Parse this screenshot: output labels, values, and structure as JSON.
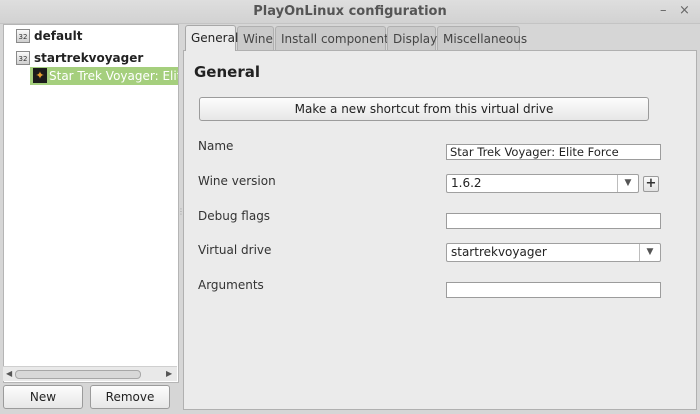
{
  "window": {
    "title": "PlayOnLinux configuration",
    "minimize_glyph": "–",
    "close_glyph": "×"
  },
  "tree": {
    "prefixes": [
      {
        "icon_text": "32",
        "label": "default"
      },
      {
        "icon_text": "32",
        "label": "startrekvoyager"
      }
    ],
    "selected_shortcut": "Star Trek Voyager:  Elite Force"
  },
  "left_buttons": {
    "new": "New",
    "remove": "Remove"
  },
  "tabs": [
    {
      "label": "General",
      "active": true
    },
    {
      "label": "Wine",
      "active": false
    },
    {
      "label": "Install components",
      "active": false
    },
    {
      "label": "Display",
      "active": false
    },
    {
      "label": "Miscellaneous",
      "active": false
    }
  ],
  "general": {
    "heading": "General",
    "shortcut_button": "Make a new shortcut from this virtual drive",
    "fields": {
      "name": {
        "label": "Name",
        "value": "Star Trek Voyager:  Elite Force"
      },
      "wine_version": {
        "label": "Wine version",
        "value": "1.6.2"
      },
      "debug_flags": {
        "label": "Debug flags",
        "value": ""
      },
      "virtual_drive": {
        "label": "Virtual drive",
        "value": "startrekvoyager"
      },
      "arguments": {
        "label": "Arguments",
        "value": ""
      }
    }
  },
  "icons": {
    "prefix": "drive-32bit-icon",
    "game": "star-trek-icon",
    "dropdown": "chevron-down-icon",
    "add": "plus-icon"
  }
}
